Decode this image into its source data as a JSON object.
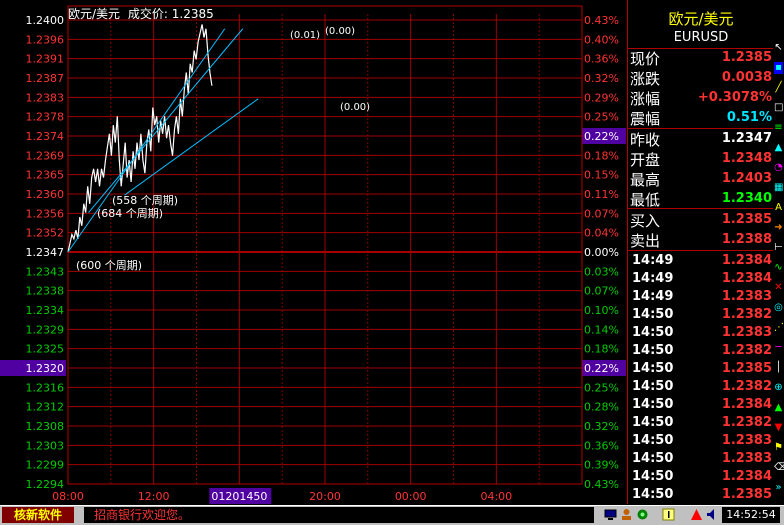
{
  "header": {
    "name": "欧元/美元",
    "price_label": "成交价:",
    "price_value": "1.2385"
  },
  "chart_data": {
    "type": "line",
    "title": "欧元/美元",
    "y_left_ticks": [
      "1.2400",
      "1.2396",
      "1.2391",
      "1.2387",
      "1.2383",
      "1.2378",
      "1.2374",
      "1.2369",
      "1.2365",
      "1.2360",
      "1.2356",
      "1.2352",
      "1.2347",
      "1.2343",
      "1.2338",
      "1.2334",
      "1.2329",
      "1.2325",
      "1.2320",
      "1.2316",
      "1.2312",
      "1.2308",
      "1.2303",
      "1.2299",
      "1.2294"
    ],
    "y_right_ticks": [
      "0.43%",
      "0.40%",
      "0.36%",
      "0.32%",
      "0.29%",
      "0.25%",
      "0.22%",
      "0.18%",
      "0.15%",
      "0.11%",
      "0.07%",
      "0.04%",
      "0.00%",
      "0.03%",
      "0.07%",
      "0.10%",
      "0.14%",
      "0.18%",
      "0.22%",
      "0.25%",
      "0.28%",
      "0.32%",
      "0.36%",
      "0.39%",
      "0.43%"
    ],
    "highlighted_left_tick": "1.2320",
    "highlighted_right_tick": "0.22%",
    "x_ticks": [
      "08:00",
      "12:00",
      "01201450",
      "20:00",
      "00:00",
      "04:00"
    ],
    "highlighted_x_tick": "01201450",
    "ylim": [
      1.2294,
      1.24
    ],
    "prev_close": 1.2347,
    "series": [
      {
        "values": [
          1.2347,
          1.2349,
          1.2351,
          1.235,
          1.2352,
          1.235,
          1.2355,
          1.2353,
          1.2358,
          1.2356,
          1.2362,
          1.2358,
          1.2364,
          1.2366,
          1.2363,
          1.2366,
          1.2362,
          1.2366,
          1.2364,
          1.2368,
          1.2371,
          1.2374,
          1.2369,
          1.2376,
          1.2372,
          1.2378,
          1.2368,
          1.2362,
          1.2367,
          1.2372,
          1.2364,
          1.2368,
          1.2363,
          1.237,
          1.2366,
          1.2372,
          1.2368,
          1.2374,
          1.2368,
          1.2365,
          1.2372,
          1.2375,
          1.237,
          1.238,
          1.2376,
          1.2378,
          1.2372,
          1.2377,
          1.2374,
          1.2378,
          1.2373,
          1.2376,
          1.2372,
          1.2369,
          1.2375,
          1.2378,
          1.2374,
          1.2382,
          1.2378,
          1.2384,
          1.2388,
          1.2383,
          1.239,
          1.2388,
          1.2393,
          1.2391,
          1.2395,
          1.2397,
          1.2399,
          1.2396,
          1.2398,
          1.2392,
          1.2388,
          1.2385
        ]
      }
    ],
    "trendlines": [
      {
        "label": "(0.01)",
        "x1": 0.0,
        "y1": 1.2347,
        "x2": 0.305,
        "y2": 1.2398
      },
      {
        "label": "(0.00)",
        "x1": 0.04,
        "y1": 1.2356,
        "x2": 0.34,
        "y2": 1.2398
      },
      {
        "label": "(0.00)",
        "x1": 0.11,
        "y1": 1.236,
        "x2": 0.37,
        "y2": 1.2382
      }
    ],
    "annotations": [
      "(558 个周期)",
      "(684 个周期)",
      "(600 个周期)"
    ]
  },
  "quote": {
    "title": "欧元/美元",
    "code": "EURUSD",
    "rows": [
      {
        "label": "现价",
        "value": "1.2385",
        "color": "#ff3333"
      },
      {
        "label": "涨跌",
        "value": "0.0038",
        "color": "#ff3333"
      },
      {
        "label": "涨幅",
        "value": "+0.3078%",
        "color": "#ff3333"
      },
      {
        "label": "震幅",
        "value": "0.51%",
        "color": "#00e5ff"
      },
      {
        "label": "昨收",
        "value": "1.2347",
        "color": "#ffffff"
      },
      {
        "label": "开盘",
        "value": "1.2348",
        "color": "#ff3333"
      },
      {
        "label": "最高",
        "value": "1.2403",
        "color": "#ff3333"
      },
      {
        "label": "最低",
        "value": "1.2340",
        "color": "#00ff00"
      },
      {
        "label": "买入",
        "value": "1.2385",
        "color": "#ff3333"
      },
      {
        "label": "卖出",
        "value": "1.2388",
        "color": "#ff3333"
      }
    ]
  },
  "ticks": [
    {
      "time": "14:49",
      "price": "1.2384"
    },
    {
      "time": "14:49",
      "price": "1.2384"
    },
    {
      "time": "14:49",
      "price": "1.2383"
    },
    {
      "time": "14:50",
      "price": "1.2382"
    },
    {
      "time": "14:50",
      "price": "1.2383"
    },
    {
      "time": "14:50",
      "price": "1.2382"
    },
    {
      "time": "14:50",
      "price": "1.2385"
    },
    {
      "time": "14:50",
      "price": "1.2382"
    },
    {
      "time": "14:50",
      "price": "1.2384"
    },
    {
      "time": "14:50",
      "price": "1.2382"
    },
    {
      "time": "14:50",
      "price": "1.2383"
    },
    {
      "time": "14:50",
      "price": "1.2383"
    },
    {
      "time": "14:50",
      "price": "1.2384"
    },
    {
      "time": "14:50",
      "price": "1.2385"
    }
  ],
  "status": {
    "logo": "核新软件",
    "message": "招商银行欢迎您。",
    "clock": "14:52:54"
  }
}
